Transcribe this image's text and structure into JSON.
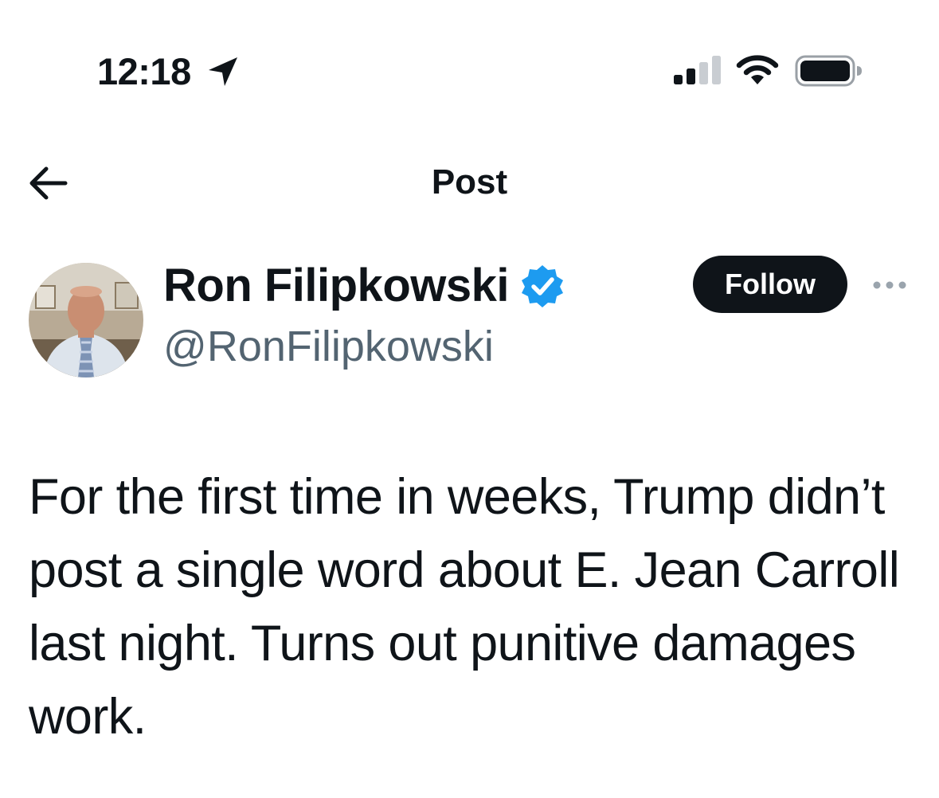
{
  "status_bar": {
    "time": "12:18",
    "location_icon": "location-arrow-icon",
    "signal_icon": "cellular-signal-icon",
    "wifi_icon": "wifi-icon",
    "battery_icon": "battery-icon"
  },
  "nav": {
    "back_icon": "back-arrow-icon",
    "title": "Post"
  },
  "author": {
    "display_name": "Ron Filipkowski",
    "verified_icon": "verified-badge-icon",
    "handle": "@RonFilipkowski",
    "follow_label": "Follow",
    "more_icon": "more-options-icon"
  },
  "tweet": {
    "text": "For the first time in weeks, Trump didn’t post a single word about E. Jean Carroll last night. Turns out punitive damages work."
  },
  "colors": {
    "text_primary": "#0f1419",
    "text_secondary": "#536471",
    "verified_blue": "#1d9bf0",
    "follow_bg": "#0f1419"
  }
}
